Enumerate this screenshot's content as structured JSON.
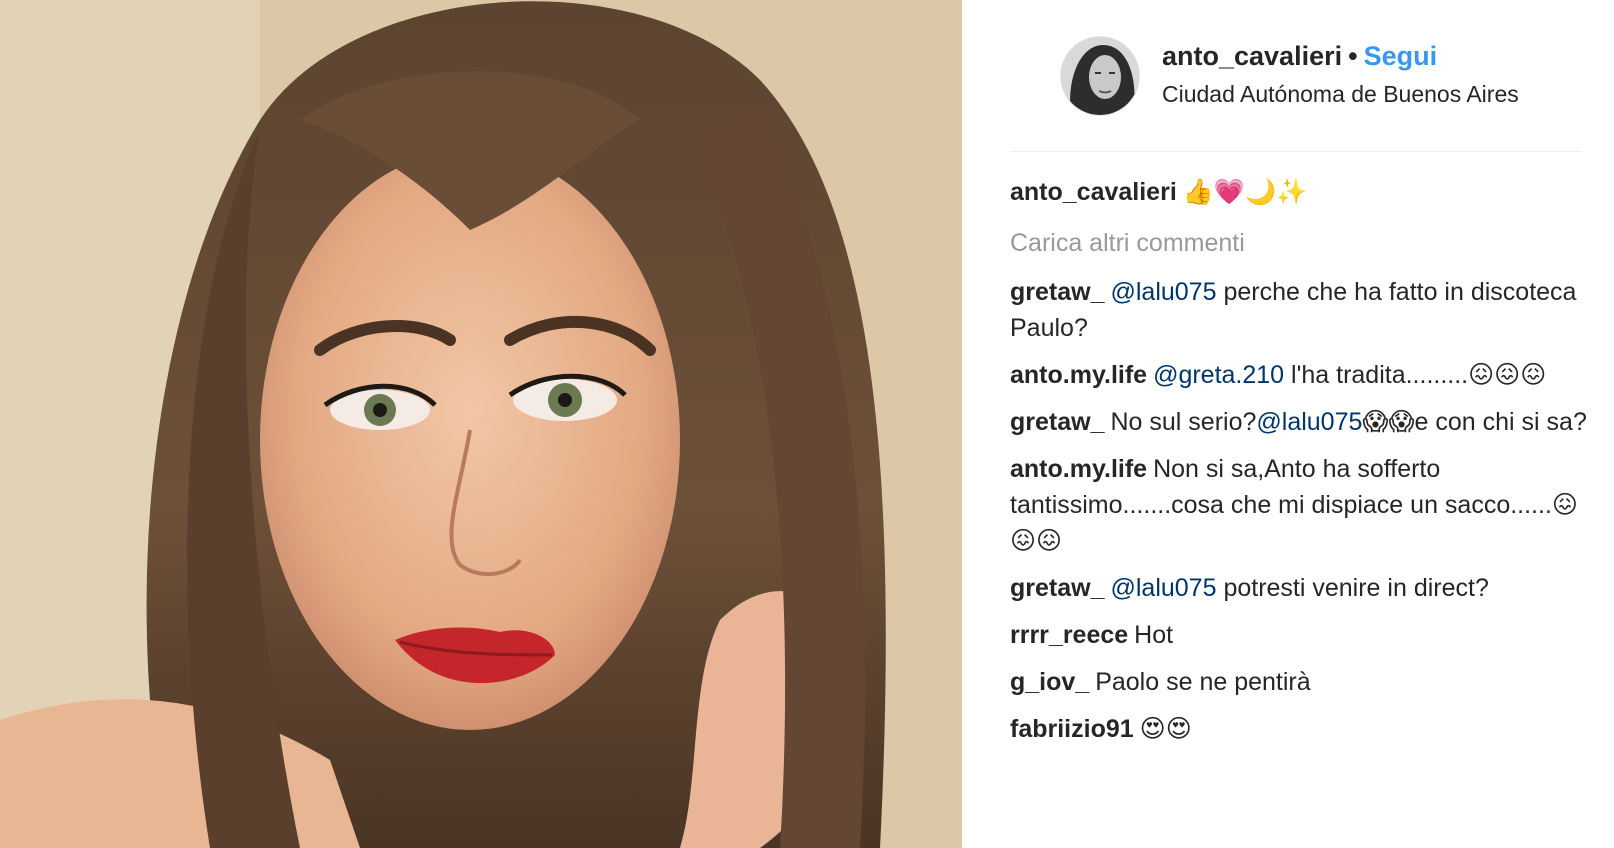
{
  "post": {
    "username": "anto_cavalieri",
    "separator": "•",
    "follow_label": "Segui",
    "location": "Ciudad Autónoma de Buenos Aires",
    "caption_user": "anto_cavalieri",
    "caption_text": "👍💗🌙✨"
  },
  "load_more_label": "Carica altri commenti",
  "comments": [
    {
      "user": "gretaw_",
      "mention": "@lalu075",
      "text": " perche che ha fatto in discoteca Paulo?"
    },
    {
      "user": "anto.my.life",
      "mention": "@greta.210",
      "text": " l'ha tradita.........😖😖😖"
    },
    {
      "user": "gretaw_",
      "pre": "No sul serio?",
      "mention": "@lalu075",
      "text": "😱😱e con chi si sa?"
    },
    {
      "user": "anto.my.life",
      "pre": "Non si sa,Anto ha sofferto tantissimo.......cosa che mi dispiace un sacco......😖😖😖"
    },
    {
      "user": "gretaw_",
      "mention": "@lalu075",
      "text": " potresti venire in direct?"
    },
    {
      "user": "rrrr_reece",
      "pre": "Hot"
    },
    {
      "user": "g_iov_",
      "pre": "Paolo se ne pentirà"
    },
    {
      "user": "fabriizio91",
      "pre": "😍😍"
    }
  ]
}
